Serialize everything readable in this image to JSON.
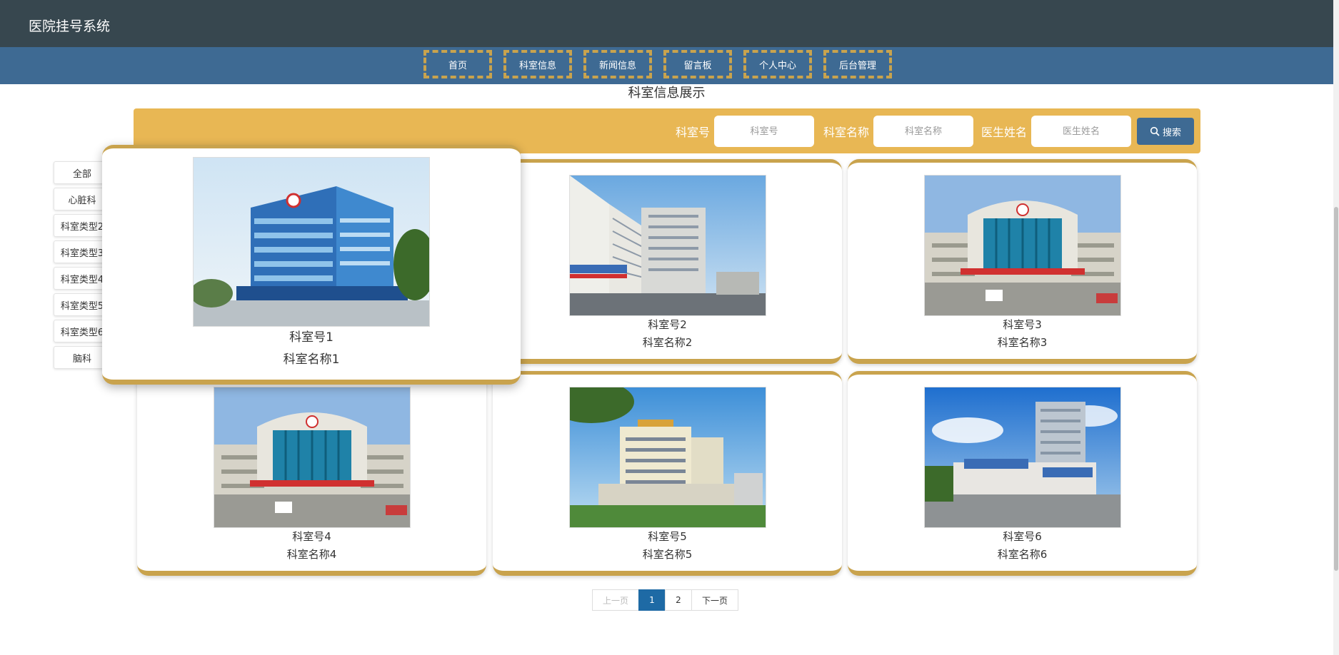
{
  "app": {
    "title": "医院挂号系统"
  },
  "nav": [
    {
      "label": "首页"
    },
    {
      "label": "科室信息"
    },
    {
      "label": "新闻信息"
    },
    {
      "label": "留言板"
    },
    {
      "label": "个人中心"
    },
    {
      "label": "后台管理"
    }
  ],
  "section": {
    "title": "科室信息展示"
  },
  "search": {
    "dept_no_label": "科室号",
    "dept_no_placeholder": "科室号",
    "dept_name_label": "科室名称",
    "dept_name_placeholder": "科室名称",
    "doctor_label": "医生姓名",
    "doctor_placeholder": "医生姓名",
    "button_label": "搜索",
    "button_icon": "search-icon"
  },
  "sidebar": [
    {
      "label": "全部"
    },
    {
      "label": "心脏科"
    },
    {
      "label": "科室类型2"
    },
    {
      "label": "科室类型3"
    },
    {
      "label": "科室类型4"
    },
    {
      "label": "科室类型5"
    },
    {
      "label": "科室类型6"
    },
    {
      "label": "脑科"
    }
  ],
  "cards": [
    {
      "no": "科室号1",
      "name": "科室名称1"
    },
    {
      "no": "科室号2",
      "name": "科室名称2"
    },
    {
      "no": "科室号3",
      "name": "科室名称3"
    },
    {
      "no": "科室号4",
      "name": "科室名称4"
    },
    {
      "no": "科室号5",
      "name": "科室名称5"
    },
    {
      "no": "科室号6",
      "name": "科室名称6"
    }
  ],
  "pagination": {
    "prev": "上一页",
    "pages": [
      "1",
      "2"
    ],
    "current": "1",
    "next": "下一页"
  },
  "colors": {
    "header": "#37474f",
    "nav": "#3e6a93",
    "accent": "#e8b754",
    "gold": "#c9a34d",
    "active_page": "#1e6aa5"
  }
}
